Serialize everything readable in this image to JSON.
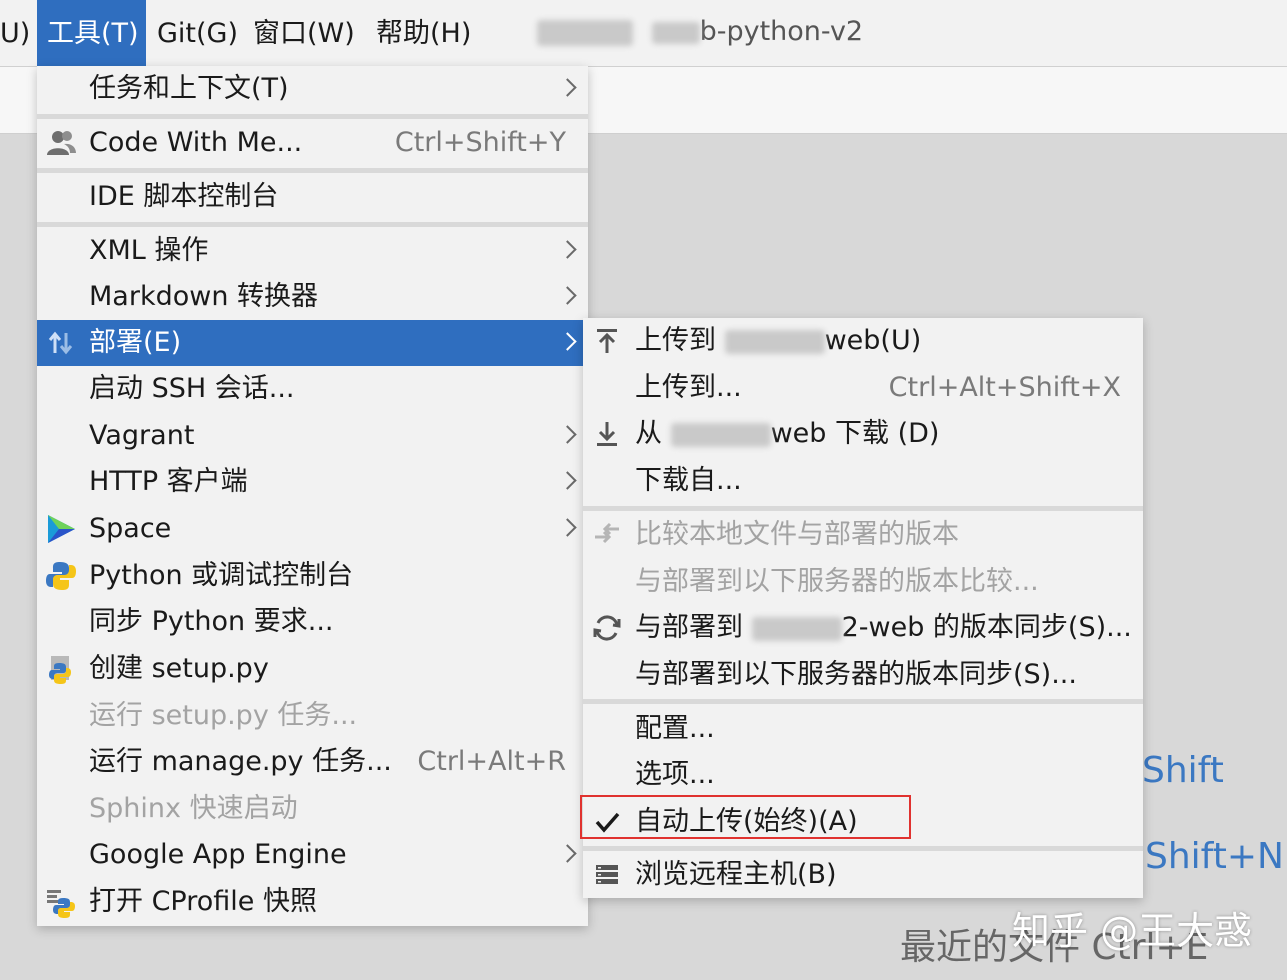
{
  "menubar": {
    "items": [
      "U)",
      "工具(T)",
      "Git(G)",
      "窗口(W)",
      "帮助(H)"
    ],
    "project_title_suffix": "b-python-v2"
  },
  "tools_menu": {
    "items": [
      {
        "label": "任务和上下文(T)",
        "submenu": true
      },
      {
        "label": "Code With Me...",
        "shortcut": "Ctrl+Shift+Y",
        "icon": "users-icon"
      },
      {
        "label": "IDE 脚本控制台"
      },
      {
        "label": "XML 操作",
        "submenu": true
      },
      {
        "label": "Markdown 转换器",
        "submenu": true
      },
      {
        "label": "部署(E)",
        "submenu": true,
        "selected": true,
        "icon": "deploy-arrows-icon"
      },
      {
        "label": "启动 SSH 会话..."
      },
      {
        "label": "Vagrant",
        "submenu": true
      },
      {
        "label": "HTTP 客户端",
        "submenu": true
      },
      {
        "label": "Space",
        "submenu": true,
        "icon": "space-logo-icon"
      },
      {
        "label": "Python 或调试控制台",
        "icon": "python-console-icon"
      },
      {
        "label": "同步 Python 要求..."
      },
      {
        "label": "创建 setup.py",
        "icon": "python-setup-icon"
      },
      {
        "label": "运行 setup.py 任务...",
        "disabled": true
      },
      {
        "label": "运行 manage.py 任务...",
        "shortcut": "Ctrl+Alt+R"
      },
      {
        "label": "Sphinx 快速启动",
        "disabled": true
      },
      {
        "label": "Google App Engine",
        "submenu": true
      },
      {
        "label": "打开 CProfile 快照",
        "icon": "cprofile-icon"
      }
    ]
  },
  "deploy_menu": {
    "upload_to_suffix": "web(U)",
    "upload_to_dots": "上传到...",
    "upload_to_dots_shortcut": "Ctrl+Alt+Shift+X",
    "download_prefix": "从",
    "download_suffix": "web 下载 (D)",
    "download_from": "下载自...",
    "compare_local": "比较本地文件与部署的版本",
    "compare_with": "与部署到以下服务器的版本比较...",
    "sync_prefix": "与部署到",
    "sync_suffix": "2-web 的版本同步(S)...",
    "sync_with": "与部署到以下服务器的版本同步(S)...",
    "configure": "配置...",
    "options": "选项...",
    "auto_upload": "自动上传(始终)(A)",
    "browse_remote": "浏览远程主机(B)",
    "upload_prefix": "上传到"
  },
  "background": {
    "hint_shift": "Shift",
    "hint_shift_n": "Shift+N",
    "recent_files": "最近的文件 Ctrl+E"
  },
  "watermark": "知乎 @王大惑"
}
